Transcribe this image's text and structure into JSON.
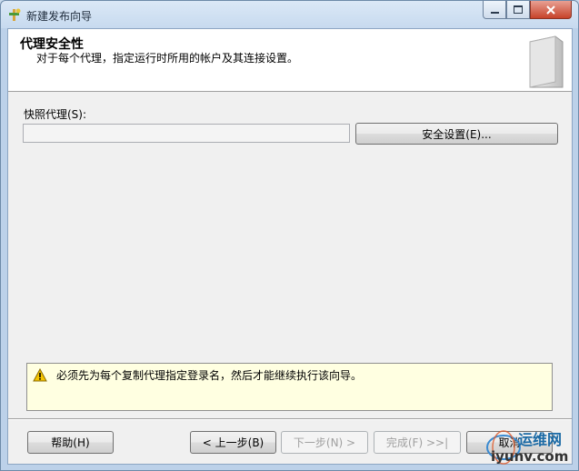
{
  "window": {
    "title": "新建发布向导"
  },
  "header": {
    "title": "代理安全性",
    "subtitle": "对于每个代理，指定运行时所用的帐户及其连接设置。"
  },
  "form": {
    "agent_label": "快照代理(S):",
    "agent_value": "",
    "security_button": "安全设置(E)..."
  },
  "warning": {
    "text": "必须先为每个复制代理指定登录名，然后才能继续执行该向导。"
  },
  "footer": {
    "help": "帮助(H)",
    "back": "< 上一步(B)",
    "next": "下一步(N) >",
    "finish": "完成(F) >>|",
    "cancel": "取消"
  },
  "watermark": {
    "brand": "运维网",
    "url": "iyunv.com"
  },
  "colors": {
    "accent": "#c7432a",
    "warning_bg": "#ffffe1",
    "window_bg": "#f0f0f0"
  }
}
